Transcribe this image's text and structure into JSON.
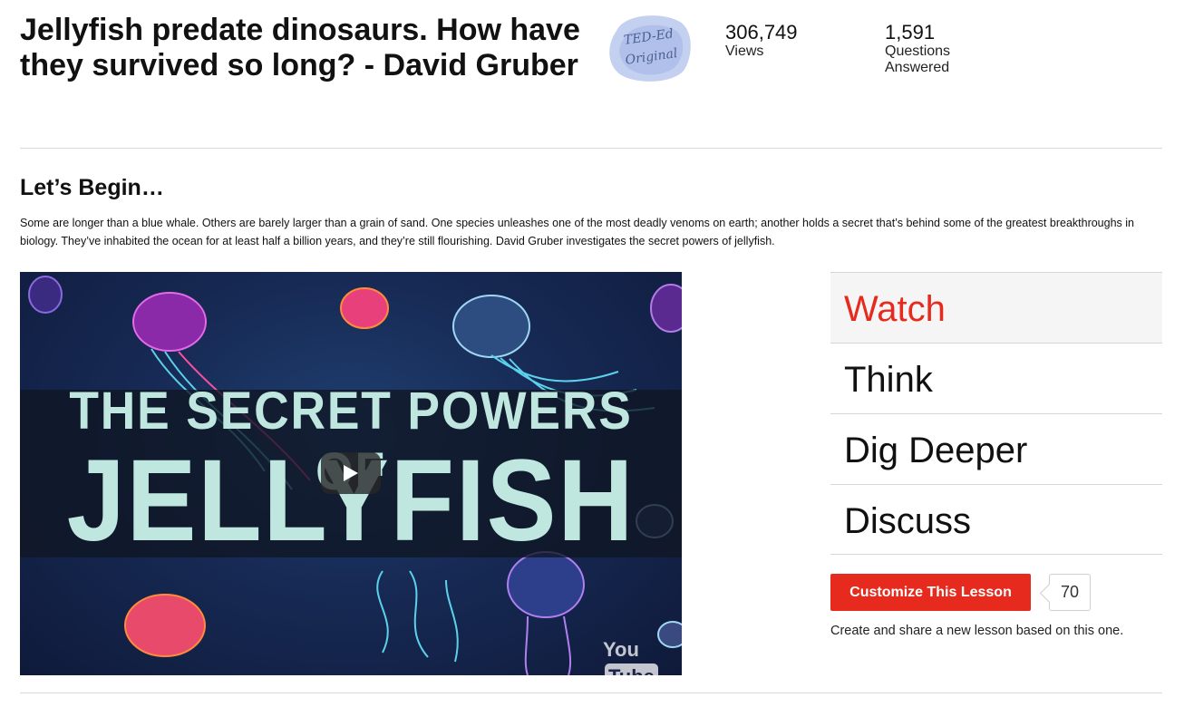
{
  "lesson": {
    "title": "Jellyfish predate dinosaurs. How have they survived so long? - David Gruber",
    "badge_text": "TED-Ed Original",
    "stats": [
      {
        "value": "306,749",
        "label": "Views"
      },
      {
        "value": "1,591",
        "label": "Questions Answered"
      }
    ]
  },
  "intro": {
    "heading": "Let’s Begin…",
    "description": "Some are longer than a blue whale. Others are barely larger than a grain of sand. One species unleashes one of the most deadly venoms on earth; another holds a secret that’s behind some of the greatest breakthroughs in biology. They’ve inhabited the ocean for at least half a billion years, and they’re still flourishing. David Gruber investigates the secret powers of jellyfish."
  },
  "video": {
    "title_line1": "THE SECRET POWERS OF",
    "title_line2": "JELLYFISH",
    "logo_you": "You",
    "logo_tube": "Tube"
  },
  "tabs": [
    {
      "label": "Watch",
      "active": true
    },
    {
      "label": "Think",
      "active": false
    },
    {
      "label": "Dig Deeper",
      "active": false
    },
    {
      "label": "Discuss",
      "active": false
    }
  ],
  "customize": {
    "button_label": "Customize This Lesson",
    "count": "70",
    "caption": "Create and share a new lesson based on this one."
  },
  "colors": {
    "accent": "#e62b1e",
    "video_text": "#bfe7df"
  }
}
